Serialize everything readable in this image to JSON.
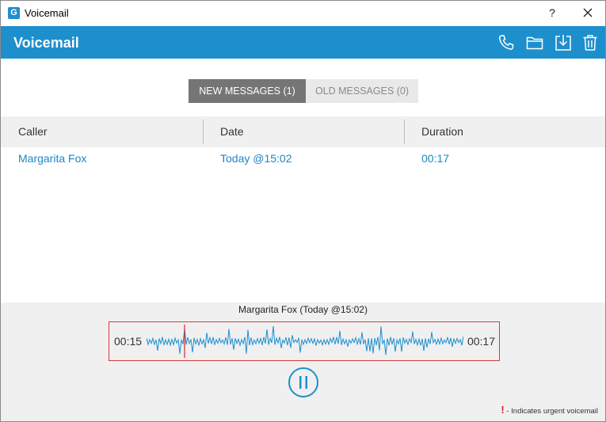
{
  "window": {
    "title": "Voicemail",
    "help": "?"
  },
  "header": {
    "title": "Voicemail"
  },
  "tabs": [
    {
      "label": "NEW MESSAGES (1)",
      "active": true
    },
    {
      "label": "OLD MESSAGES (0)",
      "active": false
    }
  ],
  "table": {
    "columns": [
      "Caller",
      "Date",
      "Duration"
    ],
    "rows": [
      {
        "caller": "Margarita Fox",
        "date": "Today @15:02",
        "duration": "00:17"
      }
    ]
  },
  "player": {
    "title": "Margarita Fox (Today @15:02)",
    "elapsed": "00:15",
    "total": "00:17",
    "playhead_fraction": 0.12,
    "state": "playing"
  },
  "footer": {
    "urgent_mark": "!",
    "urgent_text": "- Indicates urgent voicemail"
  },
  "colors": {
    "accent": "#1d8fcd",
    "link": "#1f86c6",
    "urgent": "#d9232d",
    "tab_active": "#757575"
  },
  "icons": [
    "phone-icon",
    "folder-icon",
    "download-icon",
    "trash-icon",
    "pause-icon",
    "close-icon"
  ]
}
